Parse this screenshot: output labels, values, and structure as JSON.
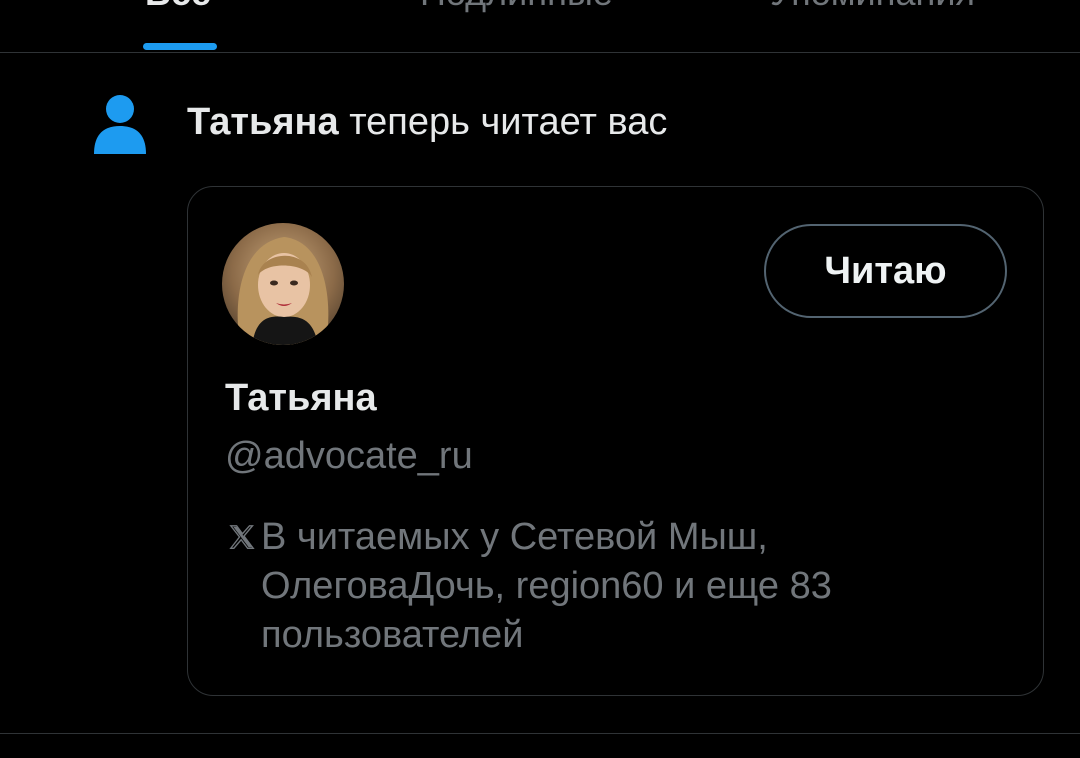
{
  "tabs": [
    {
      "label": "Все",
      "active": true
    },
    {
      "label": "Подлинные",
      "active": false
    },
    {
      "label": "Упоминания",
      "active": false
    }
  ],
  "notification": {
    "icon": "person-icon",
    "actor_name": "Татьяна",
    "action_text": " теперь читает вас"
  },
  "card": {
    "avatar": "user-avatar",
    "follow_button_label": "Читаю",
    "display_name": "Татьяна",
    "handle": "@advocate_ru",
    "followed_by_icon": "x-logo-icon",
    "followed_by_line1": "В читаемых у Сетевой Мыш,",
    "followed_by_line2": "ОлеговаДочь, region60 и еще 83 пользователей"
  },
  "colors": {
    "background": "#000000",
    "accent": "#1d9bf0",
    "text_primary": "#e7e9ea",
    "text_secondary": "#71767b",
    "border": "#2f3336"
  }
}
